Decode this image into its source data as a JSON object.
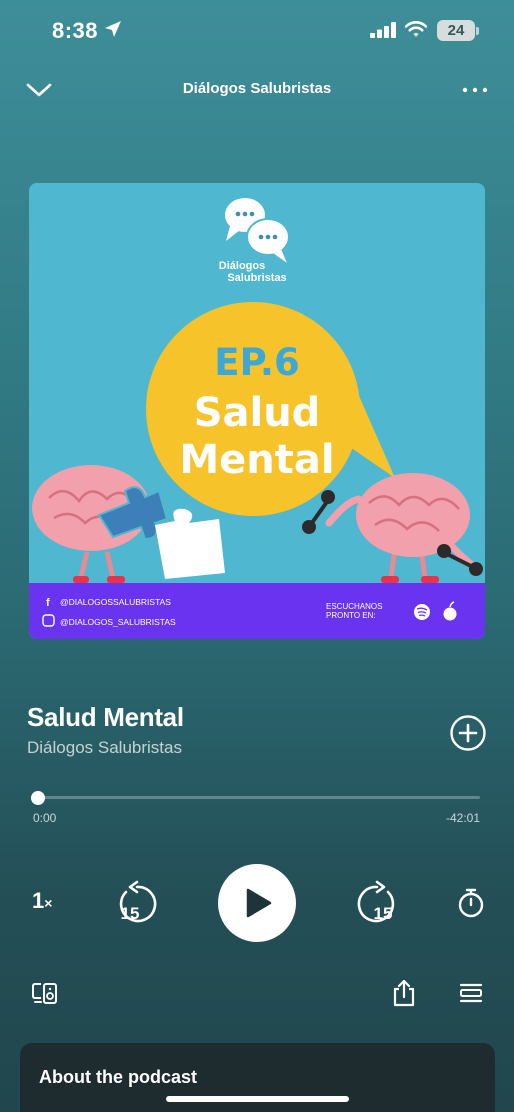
{
  "status_bar": {
    "time": "8:38",
    "battery": "24"
  },
  "header": {
    "title": "Diálogos Salubristas"
  },
  "artwork": {
    "brand_line1": "Diálogos",
    "brand_line2": "Salubristas",
    "episode_tag": "EP.6",
    "headline_line1": "Salud",
    "headline_line2": "Mental",
    "facebook_handle": "@DIALOGOSSALUBRISTAS",
    "instagram_handle": "@DIALOGOS_SALUBRISTAS",
    "cta_line1": "ESCUCHANOS",
    "cta_line2": "PRONTO EN:",
    "colors": {
      "background": "#4fb7cf",
      "bubble": "#f6c32b",
      "footer": "#6a33f0",
      "episode_tag": "#3da8d6"
    }
  },
  "episode": {
    "title": "Salud Mental",
    "show": "Diálogos Salubristas"
  },
  "player": {
    "elapsed": "0:00",
    "remaining": "-42:01",
    "progress_fraction": 0.0,
    "speed": "1",
    "speed_suffix": "×",
    "skip_back_seconds": "15",
    "skip_forward_seconds": "15"
  },
  "about": {
    "title": "About the podcast"
  },
  "icons": [
    "location-arrow-icon",
    "signal-icon",
    "wifi-icon",
    "chevron-down-icon",
    "more-icon",
    "plus-circle-icon",
    "skip-back-icon",
    "play-icon",
    "skip-forward-icon",
    "timer-icon",
    "device-icon",
    "share-icon",
    "queue-icon"
  ]
}
